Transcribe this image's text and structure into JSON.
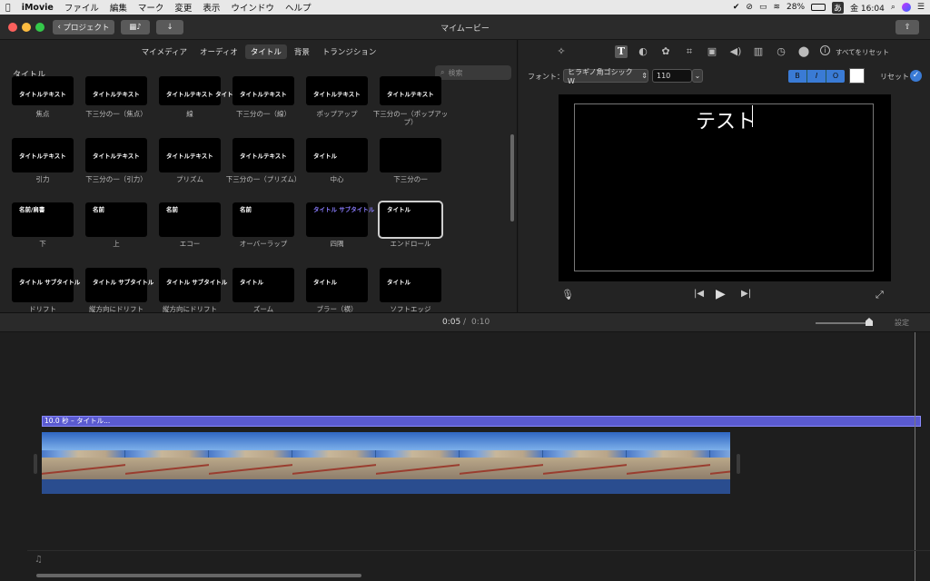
{
  "menubar": {
    "app": "iMovie",
    "items": [
      "ファイル",
      "編集",
      "マーク",
      "変更",
      "表示",
      "ウインドウ",
      "ヘルプ"
    ],
    "battery": "28%",
    "input": "あ",
    "clock": "金 16:04"
  },
  "titlebar": {
    "back_label": "プロジェクト",
    "title": "マイムービー"
  },
  "browser": {
    "tabs": [
      "マイメディア",
      "オーディオ",
      "タイトル",
      "背景",
      "トランジション"
    ],
    "active_tab": 2,
    "section_title": "タイトル",
    "search_placeholder": "検索",
    "tiles": [
      {
        "label": "焦点",
        "text": "タイトルテキスト"
      },
      {
        "label": "下三分の一（焦点）",
        "text": "タイトルテキスト"
      },
      {
        "label": "線",
        "text": "タイトルテキスト タイトルテキスト"
      },
      {
        "label": "下三分の一（線）",
        "text": "タイトルテキスト"
      },
      {
        "label": "ポップアップ",
        "text": "タイトルテキスト"
      },
      {
        "label": "下三分の一（ポップアップ）",
        "text": "タイトルテキスト"
      },
      {
        "label": "引力",
        "text": "タイトルテキスト"
      },
      {
        "label": "下三分の一（引力）",
        "text": "タイトルテキスト"
      },
      {
        "label": "プリズム",
        "text": "タイトルテキスト"
      },
      {
        "label": "下三分の一（プリズム）",
        "text": "タイトルテキスト"
      },
      {
        "label": "中心",
        "text": "タイトル"
      },
      {
        "label": "下三分の一",
        "text": ""
      },
      {
        "label": "下",
        "text": "名前/肩書"
      },
      {
        "label": "上",
        "text": "名前"
      },
      {
        "label": "エコー",
        "text": "名前"
      },
      {
        "label": "オーバーラップ",
        "text": "名前"
      },
      {
        "label": "四隅",
        "text": "タイトル サブタイトル"
      },
      {
        "label": "エンドロール",
        "text": "タイトル"
      },
      {
        "label": "ドリフト",
        "text": "タイトル サブタイトル"
      },
      {
        "label": "縦方向にドリフト",
        "text": "タイトル サブタイトル"
      },
      {
        "label": "縦方向にドリフト",
        "text": "タイトル サブタイトル"
      },
      {
        "label": "ズーム",
        "text": "タイトル"
      },
      {
        "label": "ブラー（横）",
        "text": "タイトル"
      },
      {
        "label": "ソフトエッジ",
        "text": "タイトル"
      }
    ]
  },
  "inspector": {
    "reset_all_label": "すべてをリセット",
    "font_label": "フォント：",
    "font_value": "ヒラギノ角ゴシック W",
    "size_value": "110",
    "style_bold": "B",
    "style_italic": "I",
    "style_outline": "O",
    "reset_label": "リセット"
  },
  "viewer": {
    "preview_text": "テスト"
  },
  "timeline": {
    "current_time": "0:05",
    "total_time": "0:10",
    "settings_label": "設定",
    "title_clip_label": "10.0 秒 – タイトル..."
  },
  "colors": {
    "accent": "#3a7bd5",
    "title_clip": "#5a5ad0"
  }
}
